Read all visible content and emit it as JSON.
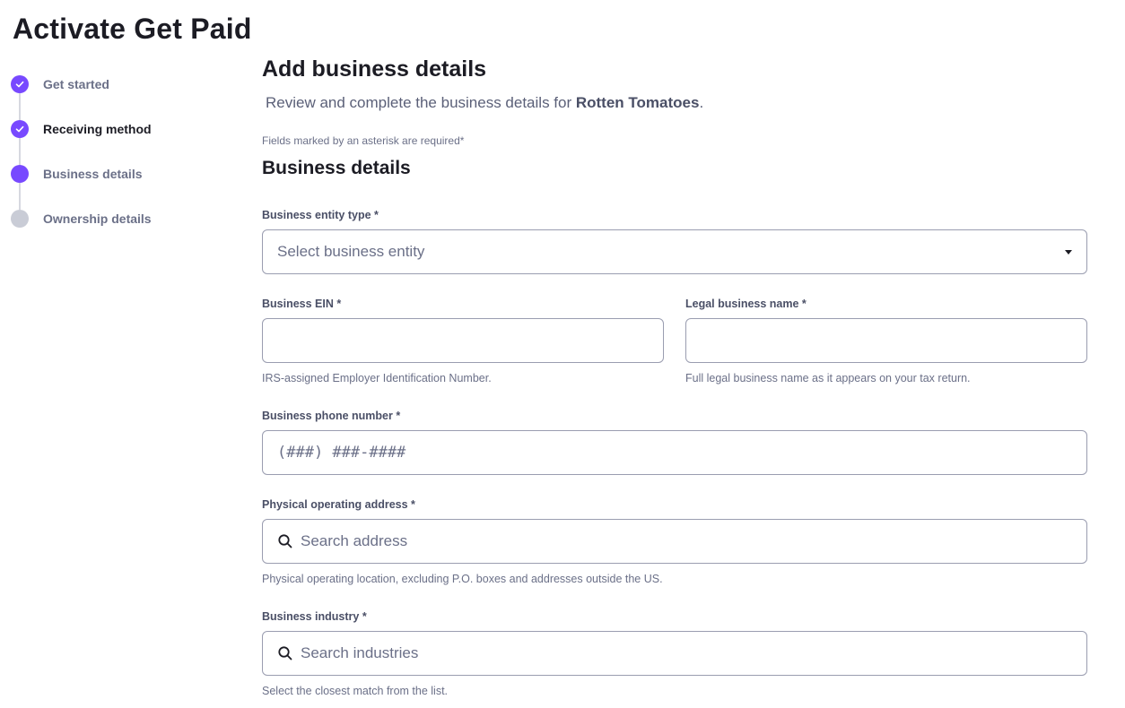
{
  "page": {
    "title": "Activate Get Paid"
  },
  "stepper": {
    "steps": [
      {
        "label": "Get started",
        "state": "done"
      },
      {
        "label": "Receiving method",
        "state": "done"
      },
      {
        "label": "Business details",
        "state": "current"
      },
      {
        "label": "Ownership details",
        "state": "pending"
      }
    ]
  },
  "main": {
    "heading": "Add business details",
    "subtitle_prefix": "Review and complete the business details for ",
    "business_name": "Rotten Tomatoes",
    "subtitle_suffix": ".",
    "required_note": "Fields marked by an asterisk are required*",
    "section_title": "Business details"
  },
  "fields": {
    "entity_type": {
      "label": "Business entity type  *",
      "placeholder": "Select business entity"
    },
    "ein": {
      "label": "Business EIN  *",
      "value": "",
      "helper": "IRS-assigned Employer Identification Number."
    },
    "legal_name": {
      "label": "Legal business name  *",
      "value": "",
      "helper": "Full legal business name as it appears on your tax return."
    },
    "phone": {
      "label": "Business phone number  *",
      "placeholder": "(###) ###-####"
    },
    "address": {
      "label": "Physical operating address  *",
      "placeholder": "Search address",
      "helper": "Physical operating location, excluding P.O. boxes and addresses outside the US."
    },
    "industry": {
      "label": "Business industry  *",
      "placeholder": "Search industries",
      "helper": "Select the closest match from the list."
    }
  },
  "colors": {
    "accent": "#7849ff",
    "pending": "#c9ccd6",
    "text": "#1c1c24",
    "muted": "#6b7088"
  }
}
